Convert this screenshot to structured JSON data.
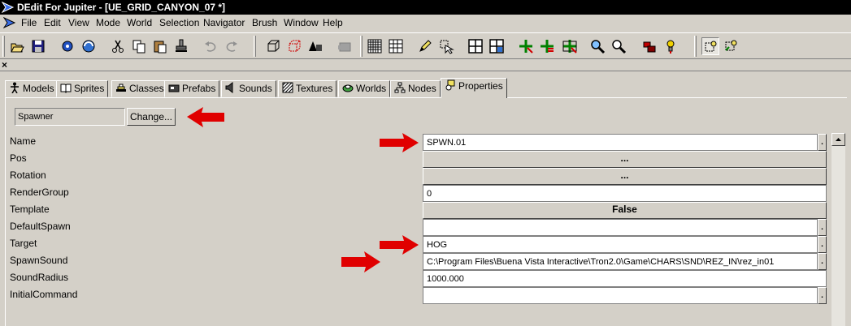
{
  "window": {
    "title": "DEdit For Jupiter - [UE_GRID_CANYON_07 *]"
  },
  "menu": [
    "File",
    "Edit",
    "View",
    "Mode",
    "World",
    "Selection",
    "Navigator",
    "Brush",
    "Window",
    "Help"
  ],
  "toolbar": {
    "buttons": [
      "open-icon",
      "save-icon",
      "import-icon",
      "process-icon",
      "cut-icon",
      "copy-icon",
      "paste-icon",
      "stamp-icon",
      "undo-icon",
      "redo-icon",
      "box-view-icon",
      "hatched-box-icon",
      "shapes-icon",
      "disabled-brush-icon",
      "grid-dense-icon",
      "grid-icon",
      "pencil-icon",
      "select-tool-icon",
      "layout-single-icon",
      "layout-quad-icon",
      "add-node-icon",
      "add-node-red-icon",
      "node-move-icon",
      "zoom-icon",
      "zoom-fit-icon",
      "object-red-icon",
      "light-icon",
      "select-pressed-icon",
      "select-yellow-icon"
    ]
  },
  "tabs": [
    {
      "label": "Models",
      "icon": "figure-icon",
      "active": false
    },
    {
      "label": "Sprites",
      "icon": "book-icon",
      "active": false
    },
    {
      "label": "Classes",
      "icon": "classes-icon",
      "active": false
    },
    {
      "label": "Prefabs",
      "icon": "prefab-icon",
      "active": false
    },
    {
      "label": "Sounds",
      "icon": "speaker-icon",
      "active": false
    },
    {
      "label": "Textures",
      "icon": "texture-icon",
      "active": false
    },
    {
      "label": "Worlds",
      "icon": "worlds-icon",
      "active": false
    },
    {
      "label": "Nodes",
      "icon": "nodes-icon",
      "active": false
    },
    {
      "label": "Properties",
      "icon": "properties-icon",
      "active": true
    }
  ],
  "object_class": {
    "value": "Spawner",
    "change_label": "Change..."
  },
  "properties": [
    {
      "name": "Name",
      "value": "SPWN.01",
      "kind": "text-dots"
    },
    {
      "name": "Pos",
      "value": "...",
      "kind": "button"
    },
    {
      "name": "Rotation",
      "value": "...",
      "kind": "button"
    },
    {
      "name": "RenderGroup",
      "value": "0",
      "kind": "text"
    },
    {
      "name": "Template",
      "value": "False",
      "kind": "button"
    },
    {
      "name": "DefaultSpawn",
      "value": "",
      "kind": "text-dots"
    },
    {
      "name": "Target",
      "value": "HOG",
      "kind": "text-dots"
    },
    {
      "name": "SpawnSound",
      "value": "C:\\Program Files\\Buena Vista Interactive\\Tron2.0\\Game\\CHARS\\SND\\REZ_IN\\rez_in01",
      "kind": "text-dots"
    },
    {
      "name": "SoundRadius",
      "value": "1000.000",
      "kind": "text"
    },
    {
      "name": "InitialCommand",
      "value": "",
      "kind": "text-dots"
    }
  ],
  "dots_label": ".",
  "colors": {
    "arrow": "#e00000",
    "titlebar": "#000000",
    "face": "#d4d0c8"
  }
}
